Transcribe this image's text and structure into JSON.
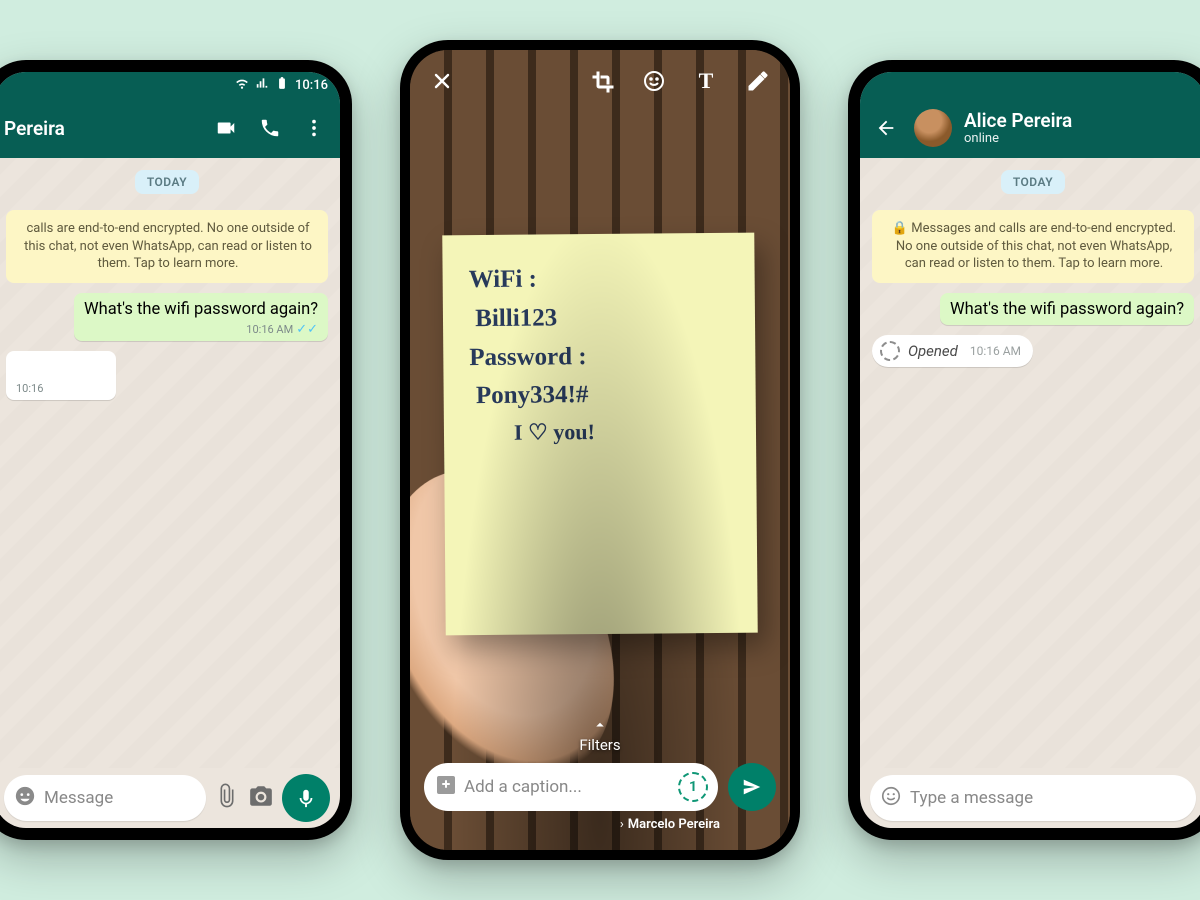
{
  "statusbar": {
    "time": "10:16"
  },
  "left": {
    "contact_name": "Pereira",
    "day_label": "TODAY",
    "e2e_text": "calls are end-to-end encrypted. No one outside of this chat, not even WhatsApp, can read or listen to them. Tap to learn more.",
    "outgoing_msg": "What's the wifi password again?",
    "outgoing_time": "10:16 AM",
    "incoming_time": "10:16",
    "input_placeholder": "Message"
  },
  "center": {
    "note_lines": [
      "WiFi :",
      " Billi123",
      "",
      "Password :",
      " Pony334!#",
      "",
      "        I ♡ you!"
    ],
    "filters_label": "Filters",
    "caption_placeholder": "Add a caption...",
    "view_once_badge": "1",
    "recipient_name": "Marcelo Pereira"
  },
  "right": {
    "contact_name": "Alice Pereira",
    "presence": "online",
    "day_label": "TODAY",
    "e2e_text": "🔒 Messages and calls are end-to-end encrypted. No one outside of this chat, not even WhatsApp, can read or listen to them. Tap to learn more.",
    "outgoing_msg": "What's the wifi password again?",
    "opened_label": "Opened",
    "opened_time": "10:16 AM",
    "input_placeholder": "Type a message"
  },
  "colors": {
    "brand": "#075e54",
    "accent": "#008069"
  }
}
